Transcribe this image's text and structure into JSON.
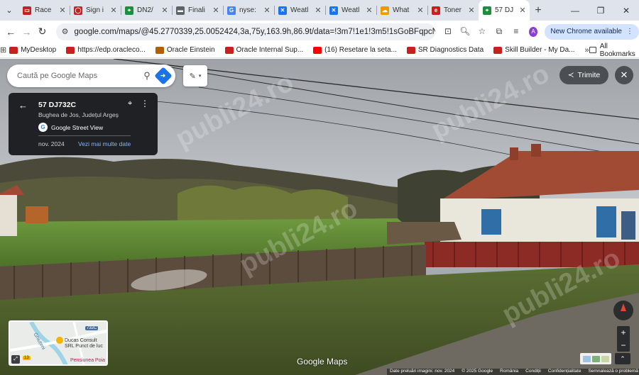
{
  "browser": {
    "tabs": [
      {
        "title": "Race",
        "color": "#c5221f",
        "glyph": "▭",
        "active": false
      },
      {
        "title": "Sign i",
        "color": "#c5221f",
        "glyph": "◯",
        "active": false
      },
      {
        "title": "DN2/",
        "color": "#1e8e3e",
        "glyph": "⌖",
        "active": false
      },
      {
        "title": "Finali",
        "color": "#5f6368",
        "glyph": "▬",
        "active": false
      },
      {
        "title": "nyse:",
        "color": "#4285f4",
        "glyph": "G",
        "active": false
      },
      {
        "title": "Weatl",
        "color": "#1a73e8",
        "glyph": "✕",
        "active": false
      },
      {
        "title": "Weatl",
        "color": "#1a73e8",
        "glyph": "✕",
        "active": false
      },
      {
        "title": "What",
        "color": "#f29900",
        "glyph": "☁",
        "active": false
      },
      {
        "title": "Toner",
        "color": "#c5221f",
        "glyph": "e",
        "active": false
      },
      {
        "title": "57 DJ",
        "color": "#1e8e3e",
        "glyph": "⌖",
        "active": true
      }
    ],
    "url": "google.com/maps/@45.2770339,25.0052424,3a,75y,163.9h,86.9t/data=!3m7!1e1!3m5!1sGoBFqpcNtY2L810t_6Dx...",
    "avatar_letter": "A",
    "new_chrome_label": "New Chrome available",
    "bookmarks": [
      {
        "label": "MyDesktop",
        "color": "#c5221f"
      },
      {
        "label": "https://edp.oracleco...",
        "color": "#c5221f"
      },
      {
        "label": "Oracle Einstein",
        "color": "#b06000"
      },
      {
        "label": "Oracle Internal Sup...",
        "color": "#c5221f"
      },
      {
        "label": "(16) Resetare la seta...",
        "color": "#ff0000"
      },
      {
        "label": "SR Diagnostics Data",
        "color": "#c5221f"
      },
      {
        "label": "Skill Builder - My Da...",
        "color": "#c5221f"
      }
    ],
    "all_bookmarks_label": "All Bookmarks"
  },
  "maps": {
    "search_placeholder": "Caută pe Google Maps",
    "share_label": "Trimite",
    "info_card": {
      "address": "57 DJ732C",
      "locality": "Bughea de Jos, Județul Argeș",
      "source": "Google Street View",
      "date": "nov. 2024",
      "more_dates": "Vezi mai multe date"
    },
    "minimap": {
      "road_badge": "732C",
      "poi_label": "Ducas Consult",
      "poi_label_2": "SRL Punct de luc",
      "road_label": "Ghiuțeni",
      "bottom_label": "Pensiunea Poia",
      "route_badge": "13"
    },
    "logo": "Google Maps",
    "footer": [
      "Date preluări imagini: nov. 2024",
      "© 2025 Google",
      "România",
      "Condiții",
      "Confidențialitate",
      "Semnalează o problemă"
    ],
    "watermark": "publi24.ro"
  }
}
